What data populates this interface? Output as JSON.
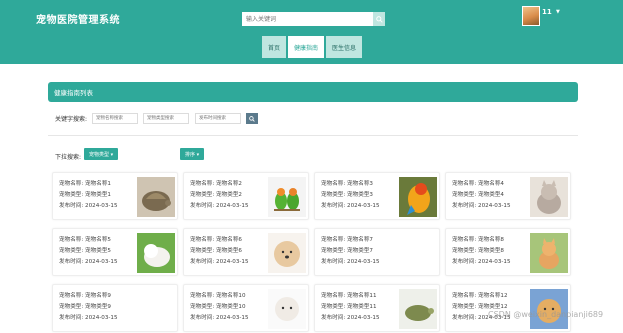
{
  "header": {
    "site_title": "宠物医院管理系统",
    "search_placeholder": "输入关键词",
    "user_name": "11",
    "user_caret": "▼"
  },
  "nav": {
    "items": [
      {
        "label": "首页",
        "active": false
      },
      {
        "label": "健康指南",
        "active": true
      },
      {
        "label": "医生信息",
        "active": false
      }
    ]
  },
  "panel": {
    "title": "健康指南列表"
  },
  "filters": {
    "keyword_label": "关键字搜索:",
    "inputs": [
      "宠物名称搜索",
      "宠物类型搜索",
      "发布时间搜索"
    ],
    "dropdown_label": "下拉搜索:",
    "pet_type_button": "宠物类型 ▾",
    "sort_button": "排序 ▾"
  },
  "cards": [
    {
      "name": "宠物名称1",
      "type": "宠物类型1",
      "date": "2024-03-15",
      "img": "tortoise"
    },
    {
      "name": "宠物名称2",
      "type": "宠物类型2",
      "date": "2024-03-15",
      "img": "lovebirds"
    },
    {
      "name": "宠物名称3",
      "type": "宠物类型3",
      "date": "2024-03-15",
      "img": "parrot"
    },
    {
      "name": "宠物名称4",
      "type": "宠物类型4",
      "date": "2024-03-15",
      "img": "kitten-grey"
    },
    {
      "name": "宠物名称5",
      "type": "宠物类型5",
      "date": "2024-03-15",
      "img": "white-dog"
    },
    {
      "name": "宠物名称6",
      "type": "宠物类型6",
      "date": "2024-03-15",
      "img": "pomeranian"
    },
    {
      "name": "宠物名称7",
      "type": "宠物类型7",
      "date": "2024-03-15",
      "img": "blank"
    },
    {
      "name": "宠物名称8",
      "type": "宠物类型8",
      "date": "2024-03-15",
      "img": "kitten-orange"
    },
    {
      "name": "宠物名称9",
      "type": "宠物类型9",
      "date": "2024-03-15",
      "img": "blank"
    },
    {
      "name": "宠物名称10",
      "type": "宠物类型10",
      "date": "2024-03-15",
      "img": "puppy-white"
    },
    {
      "name": "宠物名称11",
      "type": "宠物类型11",
      "date": "2024-03-15",
      "img": "turtle"
    },
    {
      "name": "宠物名称12",
      "type": "宠物类型12",
      "date": "2024-03-15",
      "img": "puppy-golden"
    }
  ],
  "labels": {
    "name_prefix": "宠物名称: ",
    "type_prefix": "宠物类型: ",
    "date_prefix": "发布时间: "
  },
  "watermark": "CSDN @weixin_danpianji689",
  "colors": {
    "accent": "#2fa99a",
    "nav_inactive": "#bfe6e0"
  }
}
